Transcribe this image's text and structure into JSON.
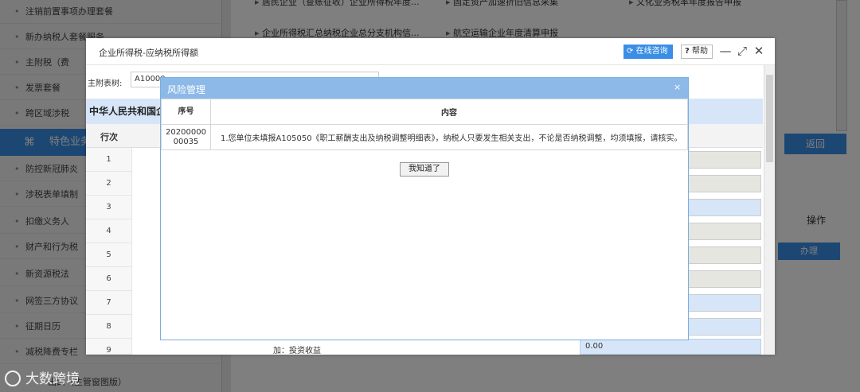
{
  "background": {
    "left_nav": {
      "items": [
        {
          "label": "注销前置事项办理套餐"
        },
        {
          "label": "新办纳税人套餐服务"
        },
        {
          "label": "主附税（费"
        },
        {
          "label": "发票套餐"
        },
        {
          "label": "跨区域涉税"
        },
        {
          "label": "防控新冠肺炎"
        },
        {
          "label": "涉税表单填制"
        },
        {
          "label": "扣缴义务人"
        },
        {
          "label": "财产和行为税"
        },
        {
          "label": "新资源税法"
        },
        {
          "label": "网签三方协议"
        },
        {
          "label": "征期日历"
        },
        {
          "label": "减税降费专栏"
        }
      ],
      "section_label": "特色业务",
      "bottom_text": "出口（主管窗图版）"
    },
    "top_links": [
      "居民企业（查账征收）企业所得税年度...",
      "固定资产加速折旧信息采集",
      "文化业务税率年度报告申报",
      "企业所得税汇总纳税企业总分支机构信...",
      "航空运输企业年度清算申报"
    ],
    "right_panel": {
      "return_label": "返回",
      "operation_label": "操作",
      "handle_label": "办理"
    },
    "watermark": "大数跨境"
  },
  "dialog": {
    "title": "企业所得税-应纳税所得额",
    "consult_label": "在线咨询",
    "help_label": "帮助",
    "toolbar": {
      "label": "主附表树:",
      "select_value": "A10000"
    },
    "form_title": "中华人民共和国企",
    "row_header_label": "行次",
    "rows": [
      "1",
      "2",
      "3",
      "4",
      "5",
      "6",
      "7",
      "8",
      "9"
    ],
    "bottom_label": "加：投资收益",
    "bottom_value": "0.00"
  },
  "risk_modal": {
    "title": "风险管理",
    "close_label": "×",
    "headers": {
      "no": "序号",
      "content": "内容"
    },
    "row": {
      "no": "2020000000035",
      "content": "1.您单位未填报A105050《职工薪酬支出及纳税调整明细表》，纳税人只要发生相关支出，不论是否纳税调整，均须填报，请核实。"
    },
    "ok_label": "我知道了"
  }
}
